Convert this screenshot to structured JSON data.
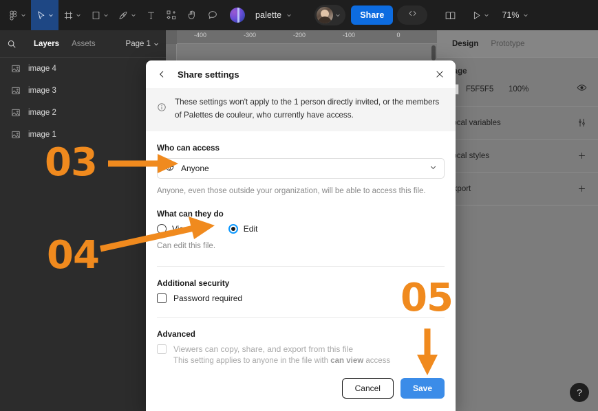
{
  "toolbar": {
    "logo_icon": "figma-logo-icon",
    "tools": [
      {
        "icon": "move-cursor-icon",
        "caret": true,
        "active": true
      },
      {
        "icon": "frame-icon",
        "caret": true,
        "active": false
      },
      {
        "icon": "rectangle-icon",
        "caret": true,
        "active": false
      },
      {
        "icon": "pen-icon",
        "caret": true,
        "active": false
      },
      {
        "icon": "text-icon",
        "caret": false,
        "active": false
      },
      {
        "icon": "components-icon",
        "caret": false,
        "active": false
      },
      {
        "icon": "hand-icon",
        "caret": false,
        "active": false
      },
      {
        "icon": "comment-icon",
        "caret": false,
        "active": false
      }
    ],
    "file_avatar_icon": "palette-thumbnail-icon",
    "file_name": "palette",
    "user_avatar_icon": "user-avatar-icon",
    "share_label": "Share",
    "dev_mode_icon": "code-brackets-icon",
    "library_icon": "book-icon",
    "present_icon": "play-icon",
    "zoom_level": "71%"
  },
  "left_panel": {
    "search_icon": "search-icon",
    "tabs": [
      {
        "label": "Layers",
        "selected": true
      },
      {
        "label": "Assets",
        "selected": false
      }
    ],
    "page_selector": "Page 1",
    "layers": [
      {
        "icon": "image-icon",
        "label": "image 4"
      },
      {
        "icon": "image-icon",
        "label": "image 3"
      },
      {
        "icon": "image-icon",
        "label": "image 2"
      },
      {
        "icon": "image-icon",
        "label": "image 1"
      }
    ]
  },
  "canvas": {
    "ruler_ticks": [
      "-400",
      "-300",
      "-200",
      "-100",
      "0"
    ]
  },
  "right_panel": {
    "tabs": [
      {
        "label": "Design",
        "selected": true
      },
      {
        "label": "Prototype",
        "selected": false
      }
    ],
    "section_title": "Page",
    "fill": {
      "hex": "F5F5F5",
      "opacity": "100%",
      "visibility_icon": "eye-icon"
    },
    "rows": [
      {
        "label": "Local variables",
        "action_icon": "sliders-icon"
      },
      {
        "label": "Local styles",
        "action_icon": "plus-icon"
      },
      {
        "label": "Export",
        "action_icon": "plus-icon"
      }
    ],
    "help_label": "?"
  },
  "modal": {
    "back_icon": "chevron-left-icon",
    "title": "Share settings",
    "close_icon": "close-icon",
    "notice": {
      "icon": "info-icon",
      "text": "These settings won't apply to the 1 person directly invited, or the members of Palettes de couleur, who currently have access."
    },
    "who_can_access": {
      "label": "Who can access",
      "select_icon": "globe-icon",
      "value": "Anyone",
      "caret_icon": "chevron-down-icon",
      "help": "Anyone, even those outside your organization, will be able to access this file."
    },
    "what_can_they_do": {
      "label": "What can they do",
      "options": [
        {
          "label": "View",
          "selected": false
        },
        {
          "label": "Edit",
          "selected": true
        }
      ],
      "help": "Can edit this file."
    },
    "additional_security": {
      "label": "Additional security",
      "checkbox_label": "Password required",
      "checked": false
    },
    "advanced": {
      "label": "Advanced",
      "checkbox_label": "Viewers can copy, share, and export from this file",
      "checked": false,
      "disabled": true,
      "note_prefix": "This setting applies to anyone in the file with ",
      "note_bold": "can view",
      "note_suffix": " access"
    },
    "footer": {
      "cancel_label": "Cancel",
      "save_label": "Save"
    }
  },
  "annotations": {
    "color": "#F08A1E",
    "steps": [
      {
        "number": "03",
        "target": "who-can-access-select"
      },
      {
        "number": "04",
        "target": "edit-radio"
      },
      {
        "number": "05",
        "target": "save-button"
      }
    ]
  }
}
